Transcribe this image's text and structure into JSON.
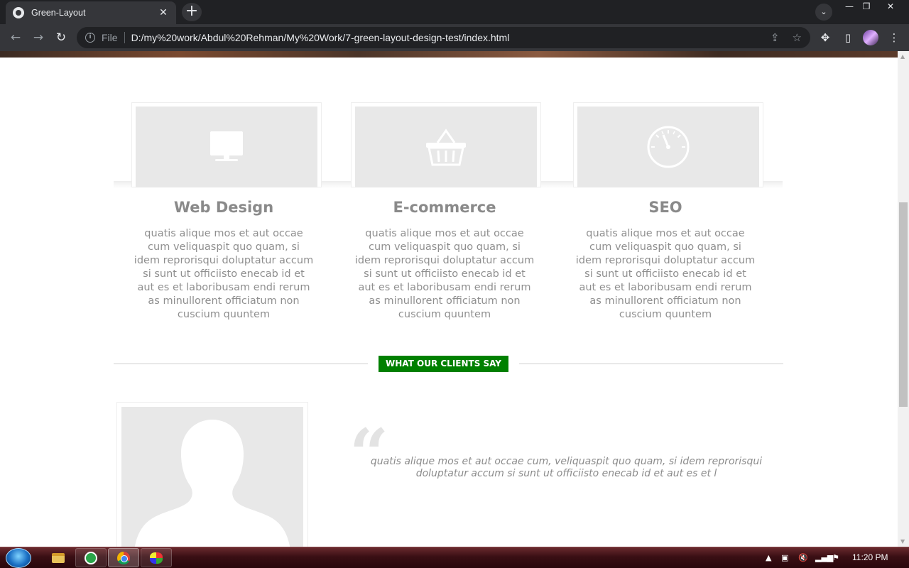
{
  "browser": {
    "tab_title": "Green-Layout",
    "tab_close": "✕",
    "new_tab": "+",
    "file_label": "File",
    "url": "D:/my%20work/Abdul%20Rehman/My%20Work/7-green-layout-design-test/index.html"
  },
  "services": [
    {
      "icon": "monitor-icon",
      "title": "Web Design",
      "text": "quatis alique mos et aut occae cum veliquaspit quo quam, si idem reprorisqui doluptatur accum si sunt ut officiisto enecab id et aut es et laboribusam endi rerum as minullorent officiatum non cuscium quuntem"
    },
    {
      "icon": "shopping-basket-icon",
      "title": "E-commerce",
      "text": "quatis alique mos et aut occae cum veliquaspit quo quam, si idem reprorisqui doluptatur accum si sunt ut officiisto enecab id et aut es et laboribusam endi rerum as minullorent officiatum non cuscium quuntem"
    },
    {
      "icon": "speedometer-icon",
      "title": "SEO",
      "text": "quatis alique mos et aut occae cum veliquaspit quo quam, si idem reprorisqui doluptatur accum si sunt ut officiisto enecab id et aut es et laboribusam endi rerum as minullorent officiatum non cuscium quuntem"
    }
  ],
  "clients": {
    "heading": "WHAT OUR CLIENTS SAY",
    "quote_mark": "“",
    "quote": "quatis alique mos et aut occae cum, veliquaspit quo quam, si idem reprorisqui doluptatur accum si sunt ut officiisto enecab id et aut es et l"
  },
  "taskbar": {
    "clock": "11:20 PM"
  },
  "colors": {
    "accent_green": "#008000",
    "text_gray": "#8a8a8a",
    "placeholder_gray": "#e8e8e8"
  }
}
